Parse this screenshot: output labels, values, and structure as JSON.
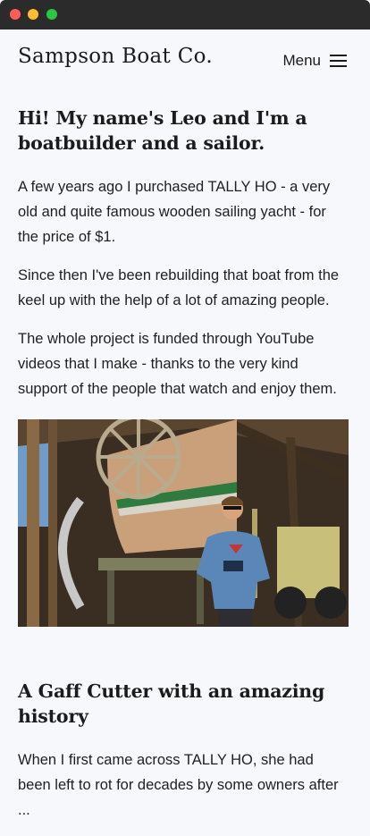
{
  "window": {
    "controls": [
      "close",
      "minimize",
      "maximize"
    ]
  },
  "header": {
    "logo": "Sampson Boat Co.",
    "menu_label": "Menu"
  },
  "intro": {
    "heading": "Hi! My name's Leo and I'm a boatbuilder and a sailor.",
    "paragraphs": [
      "A few years ago I purchased TALLY HO - a very old and quite famous wooden sailing yacht - for the price of $1.",
      "Since then I've been rebuilding that boat from the keel up with the help of a lot of amazing people.",
      "The whole project is funded through YouTube videos that I make - thanks to the very kind support of the people that watch and enjoy them."
    ]
  },
  "history": {
    "heading": "A Gaff Cutter with an amazing history",
    "paragraph": "When I first came across TALLY HO, she had been left to rot for decades by some owners after ..."
  },
  "colors": {
    "background": "#f7f8fc",
    "text": "#1b1b1b",
    "titlebar": "#2b2b2b"
  },
  "icons": [
    "hamburger-icon"
  ]
}
